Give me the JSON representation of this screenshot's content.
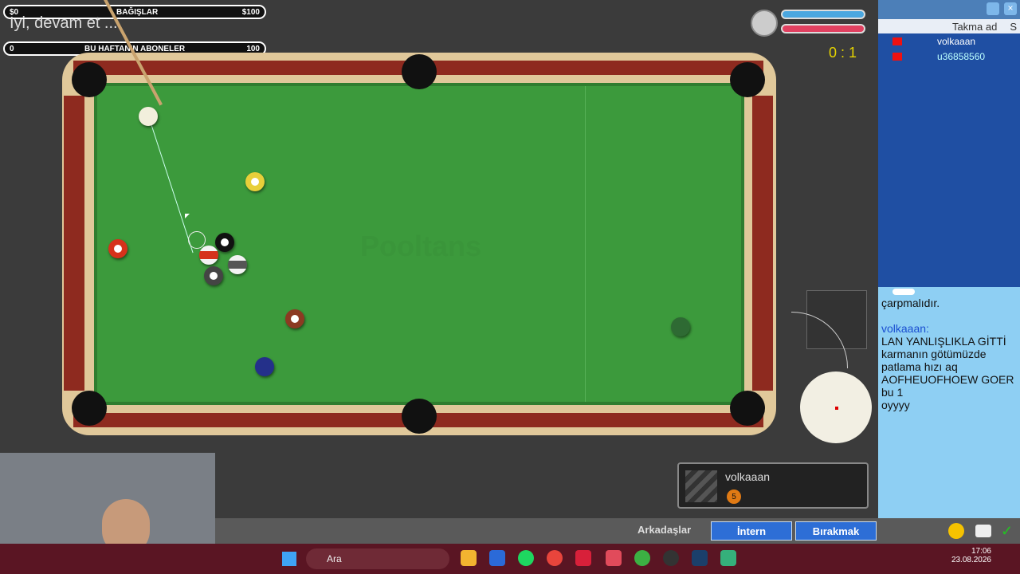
{
  "overlay": {
    "donation_bar": {
      "left": "$0",
      "center": "BAĞIŞLAR",
      "right": "$100"
    },
    "subs_bar": {
      "left": "0",
      "center": "BU HAFTANIN ABONELER",
      "right": "100"
    },
    "ticker": "İyi, devam et ..."
  },
  "game": {
    "score": "0 : 1",
    "watermark": "Pooltans",
    "current_player": {
      "name": "volkaaan",
      "ball_number": "5"
    }
  },
  "sidebar": {
    "column_header": "Takma ad",
    "users": [
      {
        "name": "volkaaan"
      },
      {
        "name": "u36858560"
      }
    ],
    "chat": [
      {
        "who": "",
        "text": "çarpmalıdır."
      },
      {
        "who": "volkaaan:",
        "text": "LAN YANLIŞLIKLA GİTTİ"
      },
      {
        "who": "",
        "text": "karmanın götümüzde patlama hızı aq"
      },
      {
        "who": "",
        "text": "AOFHEUOFHOEW GOER"
      },
      {
        "who": "",
        "text": "bu 1"
      },
      {
        "who": "",
        "text": "oyyyy"
      }
    ]
  },
  "bottom": {
    "friends": "Arkadaşlar",
    "intern": "İntern",
    "leave": "Bırakmak"
  },
  "taskbar": {
    "search": "Ara",
    "time": "17:06",
    "date": "23.08.2026"
  }
}
